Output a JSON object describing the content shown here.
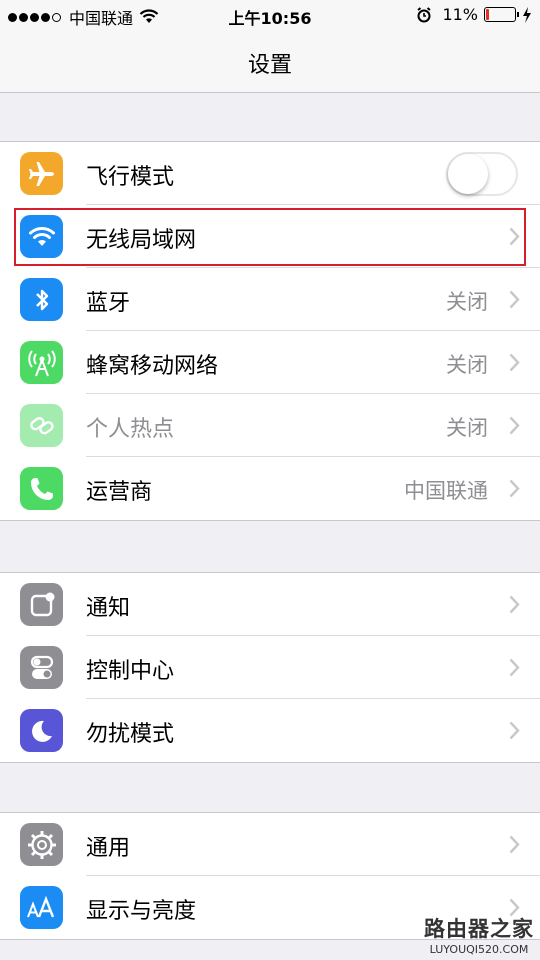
{
  "status_bar": {
    "carrier": "中国联通",
    "time": "上午10:56",
    "battery": "11%",
    "battery_level": 0.11
  },
  "nav": {
    "title": "设置"
  },
  "groups": [
    {
      "items": [
        {
          "label": "飞行模式",
          "icon": "airplane-icon",
          "icon_color": "#f4a82b",
          "control": "toggle",
          "toggle_on": false
        },
        {
          "label": "无线局域网",
          "icon": "wifi-icon",
          "icon_color": "#1b8cf3",
          "value": "",
          "highlighted": true
        },
        {
          "label": "蓝牙",
          "icon": "bluetooth-icon",
          "icon_color": "#1b8cf3",
          "value": "关闭"
        },
        {
          "label": "蜂窝移动网络",
          "icon": "cellular-icon",
          "icon_color": "#4cd964",
          "value": "关闭"
        },
        {
          "label": "个人热点",
          "icon": "hotspot-icon",
          "icon_color": "#4cd964",
          "value": "关闭",
          "disabled": true
        },
        {
          "label": "运营商",
          "icon": "phone-icon",
          "icon_color": "#4cd964",
          "value": "中国联通"
        }
      ]
    },
    {
      "items": [
        {
          "label": "通知",
          "icon": "notification-icon",
          "icon_color": "#8e8e93"
        },
        {
          "label": "控制中心",
          "icon": "control-center-icon",
          "icon_color": "#8e8e93"
        },
        {
          "label": "勿扰模式",
          "icon": "moon-icon",
          "icon_color": "#5856d6"
        }
      ]
    },
    {
      "items": [
        {
          "label": "通用",
          "icon": "gear-icon",
          "icon_color": "#8e8e93"
        },
        {
          "label": "显示与亮度",
          "icon": "display-icon",
          "icon_color": "#1b8cf3"
        }
      ]
    }
  ],
  "watermark": {
    "line1": "路由器之家",
    "line2": "LUYOUQI520.COM"
  }
}
